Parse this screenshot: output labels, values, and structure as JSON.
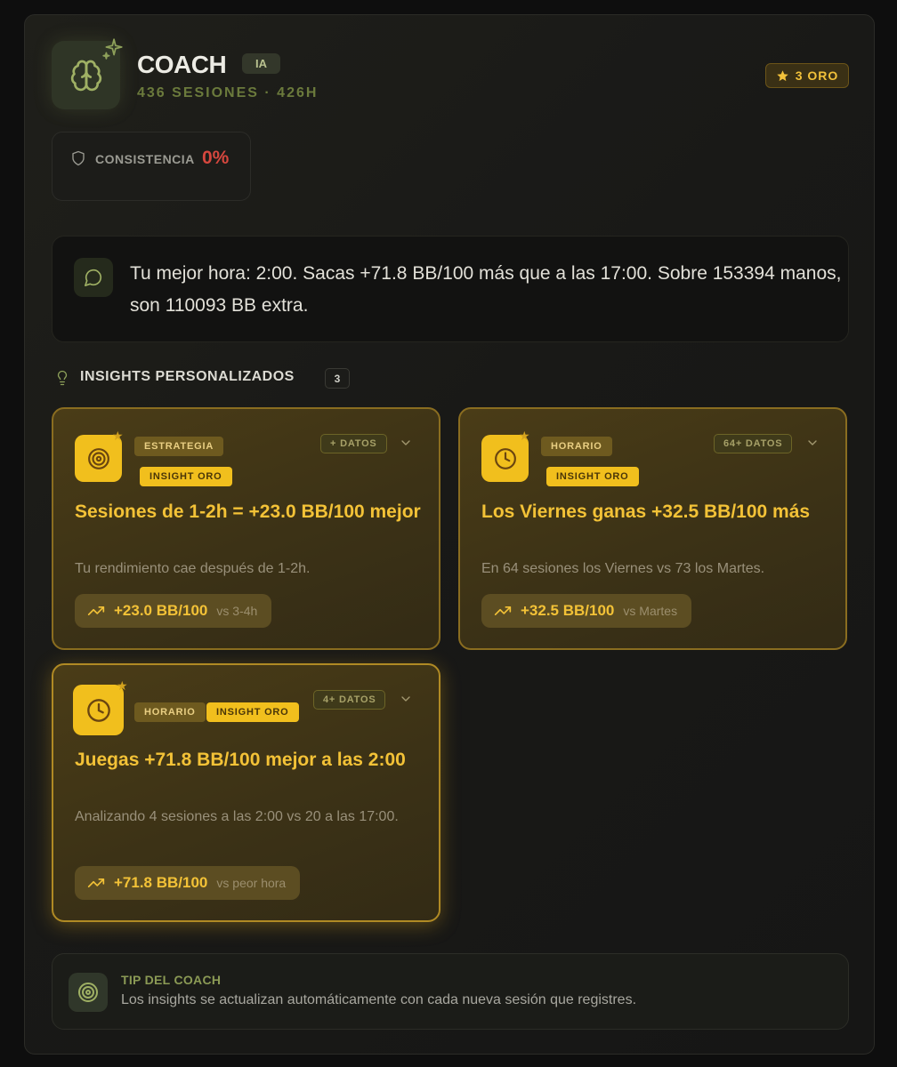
{
  "header": {
    "title": "COACH",
    "ia_badge": "IA",
    "subtitle": "436 SESIONES · 426H",
    "oro_badge": "3 ORO"
  },
  "consistency": {
    "label": "CONSISTENCIA",
    "value": "0%"
  },
  "message": {
    "text": "Tu mejor hora: 2:00. Sacas +71.8 BB/100 más que a las 17:00. Sobre 153394 manos, son 110093 BB extra."
  },
  "insights_section": {
    "title": "INSIGHTS PERSONALIZADOS",
    "count": "3"
  },
  "insights": [
    {
      "icon": "target-icon",
      "category": "ESTRATEGIA",
      "gold_tag": "INSIGHT ORO",
      "datos": "+ DATOS",
      "title": "Sesiones de 1-2h = +23.0 BB/100 mejor",
      "description": "Tu rendimiento cae después de 1-2h.",
      "stat_value": "+23.0 BB/100",
      "stat_vs": "vs 3-4h"
    },
    {
      "icon": "clock-icon",
      "category": "HORARIO",
      "gold_tag": "INSIGHT ORO",
      "datos": "64+ DATOS",
      "title": "Los Viernes ganas +32.5 BB/100 más",
      "description": "En 64 sesiones los Viernes vs 73 los Martes.",
      "stat_value": "+32.5 BB/100",
      "stat_vs": "vs Martes"
    },
    {
      "icon": "clock-icon",
      "category": "HORARIO",
      "gold_tag": "INSIGHT ORO",
      "datos": "4+ DATOS",
      "title": "Juegas +71.8 BB/100 mejor a las 2:00",
      "description": "Analizando 4 sesiones a las 2:00 vs 20 a las 17:00.",
      "stat_value": "+71.8 BB/100",
      "stat_vs": "vs peor hora"
    }
  ],
  "tip": {
    "title": "TIP DEL COACH",
    "text": "Los insights se actualizan automáticamente con cada nueva sesión que registres."
  },
  "colors": {
    "gold": "#f3c237",
    "gold_icon_bg": "#f1bf1d",
    "olive": "#6b7a3c",
    "danger": "#d6473e"
  }
}
